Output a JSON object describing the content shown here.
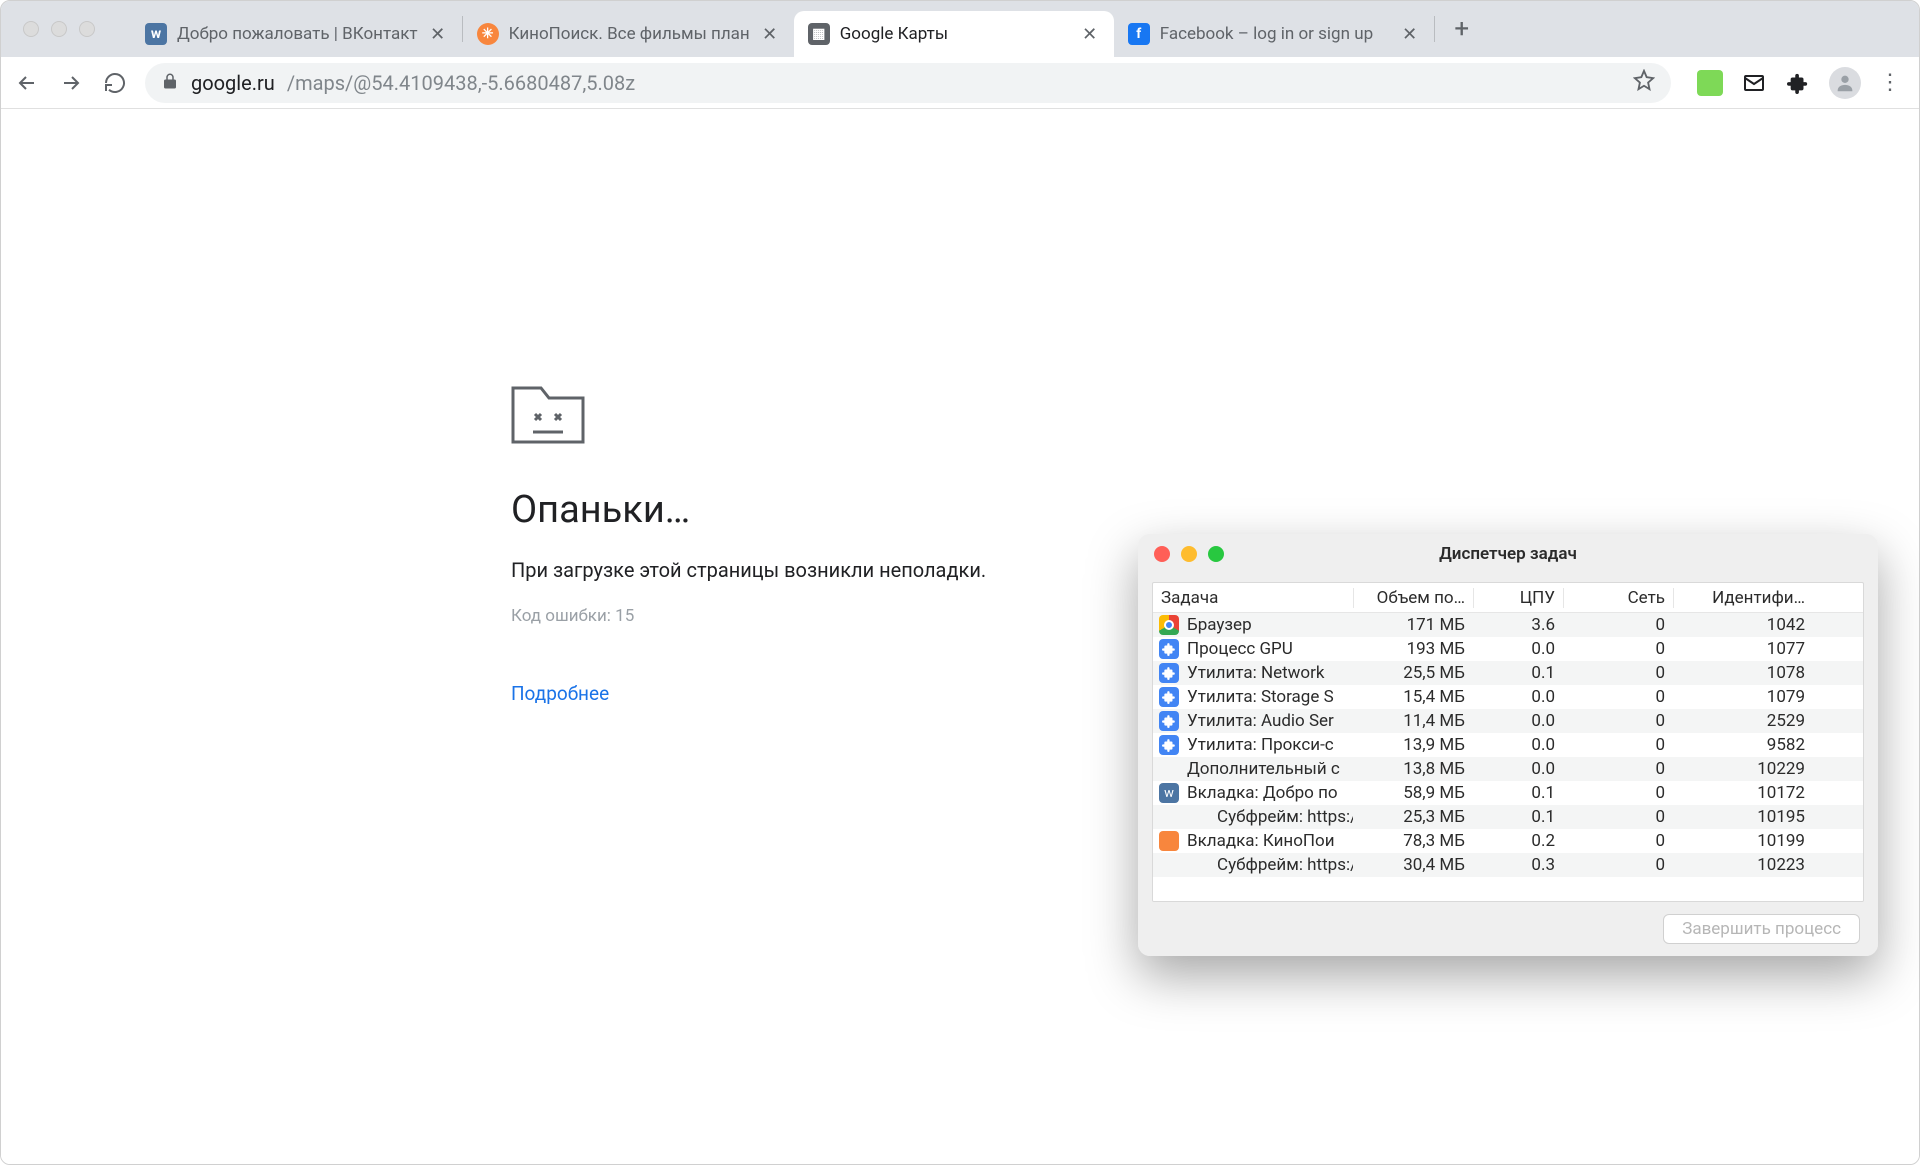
{
  "tabs": [
    {
      "label": "Добро пожаловать | ВКонтакт",
      "favicon": "vk",
      "active": false
    },
    {
      "label": "КиноПоиск. Все фильмы план",
      "favicon": "kino",
      "active": false
    },
    {
      "label": "Google Карты",
      "favicon": "gmap",
      "active": true
    },
    {
      "label": "Facebook – log in or sign up",
      "favicon": "fb",
      "active": false
    }
  ],
  "address": {
    "host": "google.ru",
    "path": "/maps/@54.4109438,-5.6680487,5.08z"
  },
  "error_page": {
    "heading": "Опаньки…",
    "message": "При загрузке этой страницы возникли неполадки.",
    "code_line": "Код ошибки: 15",
    "learn_more": "Подробнее"
  },
  "task_manager": {
    "title": "Диспетчер задач",
    "columns": {
      "task": "Задача",
      "mem": "Объем по…",
      "cpu": "ЦПУ",
      "net": "Сеть",
      "pid": "Идентифи…"
    },
    "rows": [
      {
        "icon": "chrome",
        "indent": false,
        "task": "Браузер",
        "mem": "171 МБ",
        "cpu": "3.6",
        "net": "0",
        "pid": "1042"
      },
      {
        "icon": "ext",
        "indent": false,
        "task": "Процесс GPU",
        "mem": "193 МБ",
        "cpu": "0.0",
        "net": "0",
        "pid": "1077"
      },
      {
        "icon": "ext",
        "indent": false,
        "task": "Утилита: Network",
        "mem": "25,5 МБ",
        "cpu": "0.1",
        "net": "0",
        "pid": "1078"
      },
      {
        "icon": "ext",
        "indent": false,
        "task": "Утилита: Storage S",
        "mem": "15,4 МБ",
        "cpu": "0.0",
        "net": "0",
        "pid": "1079"
      },
      {
        "icon": "ext",
        "indent": false,
        "task": "Утилита: Audio Ser",
        "mem": "11,4 МБ",
        "cpu": "0.0",
        "net": "0",
        "pid": "2529"
      },
      {
        "icon": "ext",
        "indent": false,
        "task": "Утилита: Прокси-с",
        "mem": "13,9 МБ",
        "cpu": "0.0",
        "net": "0",
        "pid": "9582"
      },
      {
        "icon": "blank",
        "indent": false,
        "task": "Дополнительный с",
        "mem": "13,8 МБ",
        "cpu": "0.0",
        "net": "0",
        "pid": "10229"
      },
      {
        "icon": "vk",
        "indent": false,
        "task": "Вкладка: Добро по",
        "mem": "58,9 МБ",
        "cpu": "0.1",
        "net": "0",
        "pid": "10172"
      },
      {
        "icon": "blank",
        "indent": true,
        "task": "Субфрейм: https:/",
        "mem": "25,3 МБ",
        "cpu": "0.1",
        "net": "0",
        "pid": "10195"
      },
      {
        "icon": "kino",
        "indent": false,
        "task": "Вкладка: КиноПои",
        "mem": "78,3 МБ",
        "cpu": "0.2",
        "net": "0",
        "pid": "10199"
      },
      {
        "icon": "blank",
        "indent": true,
        "task": "Субфрейм: https:/",
        "mem": "30,4 МБ",
        "cpu": "0.3",
        "net": "0",
        "pid": "10223"
      }
    ],
    "end_process": "Завершить процесс"
  }
}
